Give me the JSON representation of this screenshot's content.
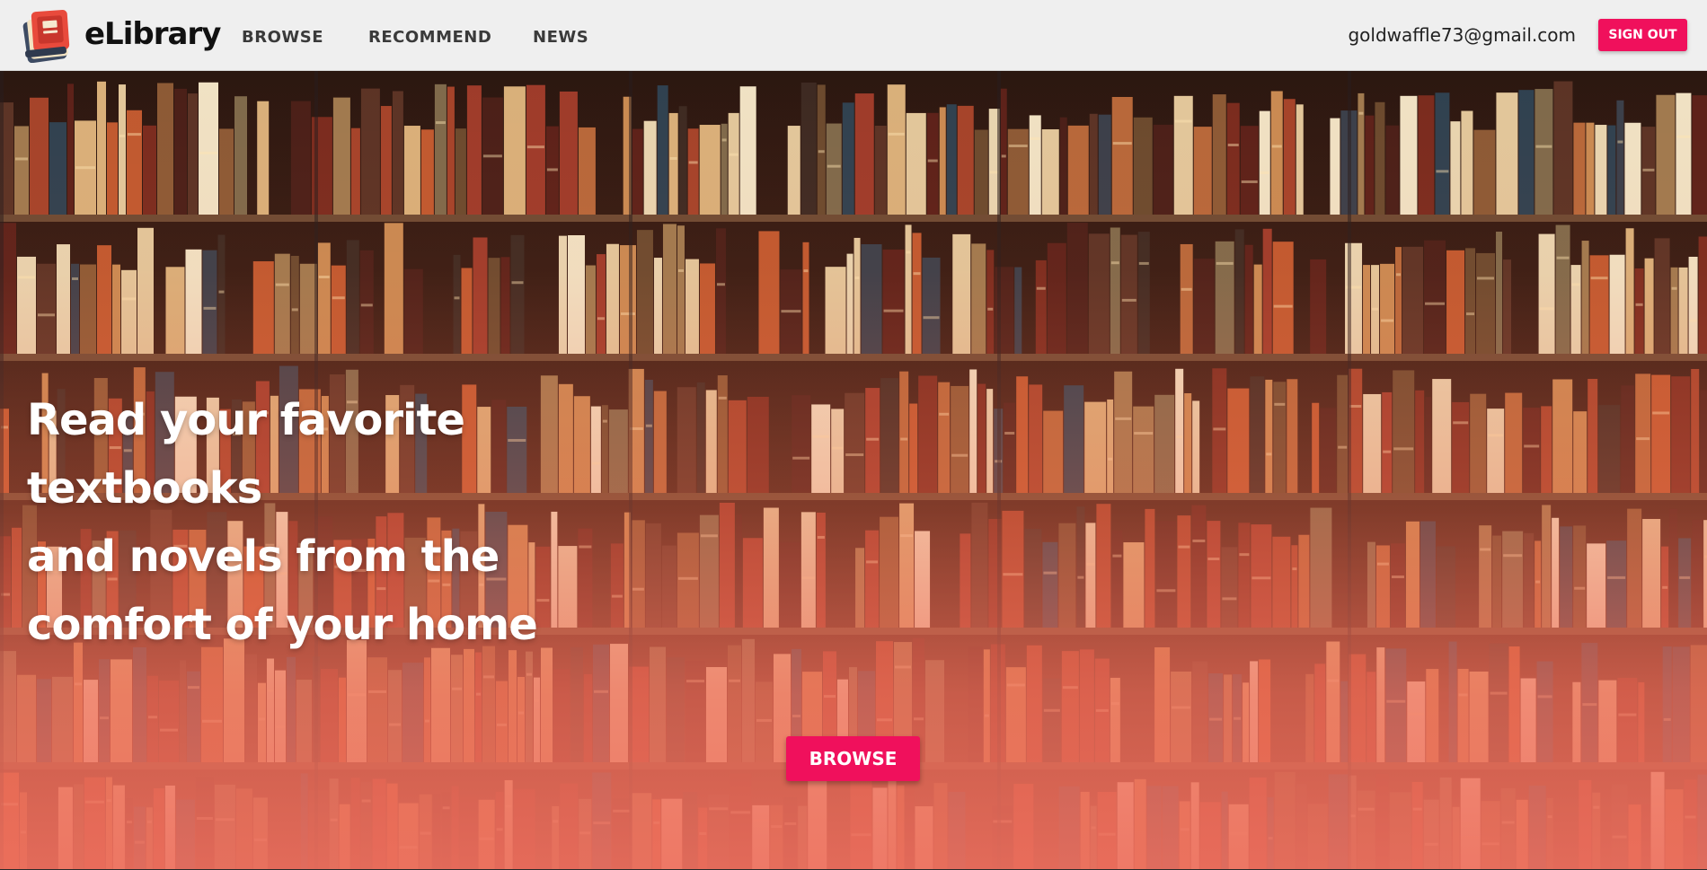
{
  "navbar": {
    "brand": "eLibrary",
    "logo_icon": "book-stack-icon",
    "links": [
      "BROWSE",
      "RECOMMEND",
      "NEWS"
    ],
    "user_email": "goldwaffle73@gmail.com",
    "signout_label": "SIGN OUT"
  },
  "hero": {
    "headline_lines": [
      "Read your favorite",
      "textbooks",
      "and novels from the",
      "comfort of your home"
    ],
    "browse_label": "BROWSE",
    "background": "bookshelves-photo"
  },
  "colors": {
    "accent": "#f0105c",
    "navbar_bg": "#efefef",
    "overlay": "#ee705f",
    "text_on_hero": "#ffffff"
  }
}
